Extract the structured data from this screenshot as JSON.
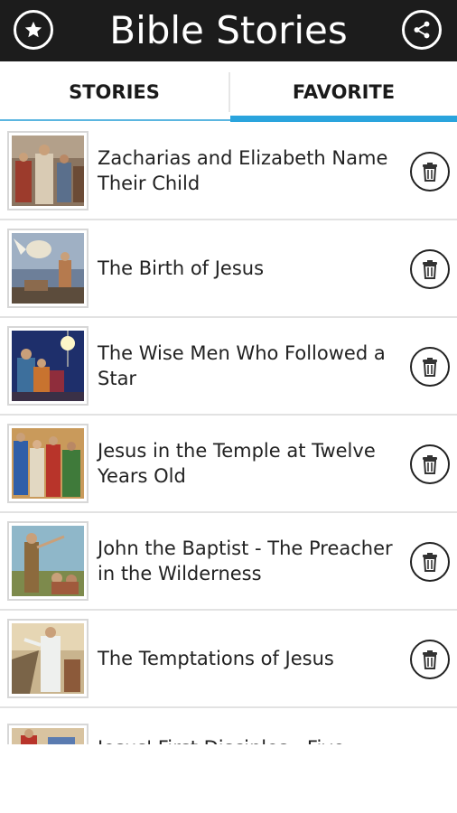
{
  "header": {
    "title": "Bible Stories",
    "left_icon": "star-icon",
    "right_icon": "share-icon"
  },
  "tabs": [
    {
      "label": "STORIES",
      "selected": false
    },
    {
      "label": "FAVORITE",
      "selected": true
    }
  ],
  "colors": {
    "header_bg": "#1c1c1c",
    "tab_accent": "#2aa4dd",
    "text": "#222222"
  },
  "stories": [
    {
      "title": "Zacharias and Elizabeth Name Their Child",
      "action_icon": "trash-icon"
    },
    {
      "title": "The Birth of Jesus",
      "action_icon": "trash-icon"
    },
    {
      "title": "The Wise Men Who Followed a Star",
      "action_icon": "trash-icon"
    },
    {
      "title": "Jesus in the Temple at Twelve Years Old",
      "action_icon": "trash-icon"
    },
    {
      "title": "John the Baptist - The Preacher in the Wilderness",
      "action_icon": "trash-icon"
    },
    {
      "title": "The Temptations of Jesus",
      "action_icon": "trash-icon"
    },
    {
      "title": "Jesus' First Disciples - Five",
      "action_icon": "trash-icon"
    }
  ]
}
